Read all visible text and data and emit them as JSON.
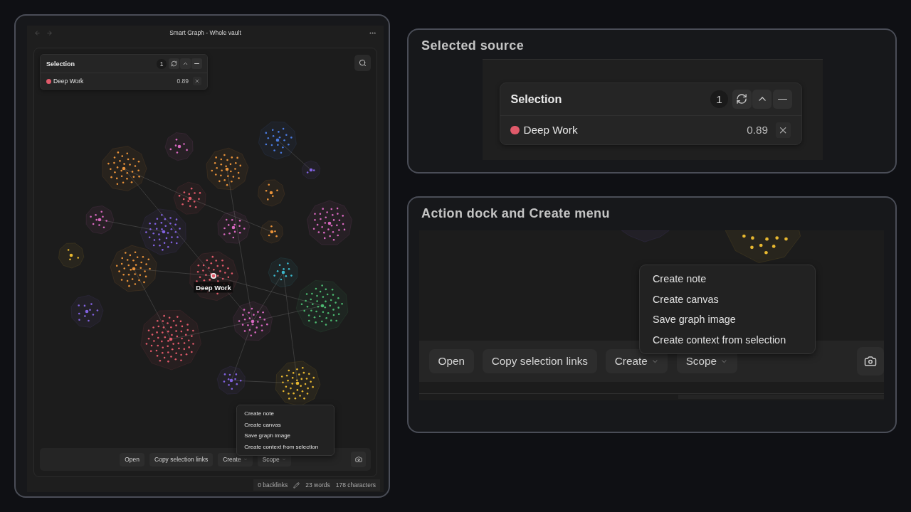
{
  "window": {
    "title": "Smart Graph - Whole vault"
  },
  "selection": {
    "title": "Selection",
    "count": "1",
    "items": [
      {
        "name": "Deep Work",
        "color": "#e05a6a",
        "score": "0.89"
      }
    ]
  },
  "graph": {
    "focus_label": "Deep Work"
  },
  "dock": {
    "buttons": [
      {
        "label": "Open",
        "kind": "plain"
      },
      {
        "label": "Copy selection links",
        "kind": "plain"
      },
      {
        "label": "Create",
        "kind": "dropdown"
      },
      {
        "label": "Scope",
        "kind": "dropdown"
      }
    ],
    "create_menu": [
      "Create note",
      "Create canvas",
      "Save graph image",
      "Create context from selection"
    ]
  },
  "status_bar": {
    "backlinks": "0 backlinks",
    "words": "23 words",
    "characters": "178 characters"
  },
  "callouts": {
    "selected_source": {
      "title": "Selected source",
      "selection": {
        "title": "Selection",
        "count": "1",
        "items": [
          {
            "name": "Deep Work",
            "color": "#e05a6a",
            "score": "0.89"
          }
        ]
      }
    },
    "action_dock": {
      "title": "Action dock and Create menu",
      "dock": {
        "buttons": [
          {
            "label": "Open",
            "kind": "plain"
          },
          {
            "label": "Copy selection links",
            "kind": "plain"
          },
          {
            "label": "Create",
            "kind": "dropdown"
          },
          {
            "label": "Scope",
            "kind": "dropdown"
          }
        ],
        "create_menu": [
          "Create note",
          "Create canvas",
          "Save graph image",
          "Create context from selection"
        ]
      }
    }
  }
}
